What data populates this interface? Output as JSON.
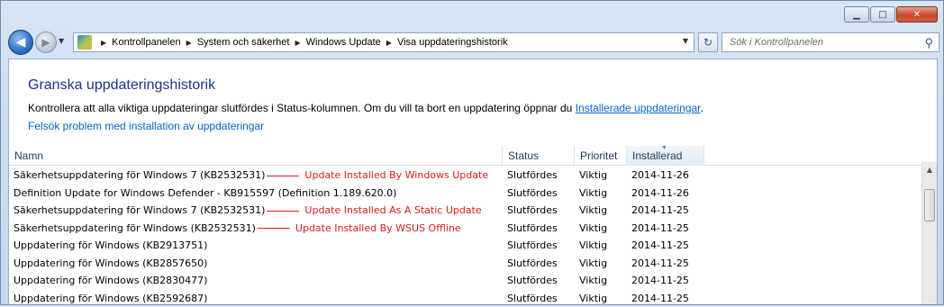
{
  "window": {
    "caption_buttons": {
      "minimize": "▁",
      "maximize": "□",
      "close": "✕"
    }
  },
  "nav": {
    "back_icon": "◀",
    "forward_icon": "▶",
    "breadcrumbs": [
      "Kontrollpanelen",
      "System och säkerhet",
      "Windows Update",
      "Visa uppdateringshistorik"
    ],
    "search_placeholder": "Sök i Kontrollpanelen"
  },
  "page": {
    "title": "Granska uppdateringshistorik",
    "description": "Kontrollera att alla viktiga uppdateringar slutfördes i Status-kolumnen. Om du vill ta bort en uppdatering öppnar du ",
    "description_link": "Installerade uppdateringar",
    "description_end": ".",
    "troubleshoot_link": "Felsök problem med installation av uppdateringar"
  },
  "table": {
    "columns": [
      "Namn",
      "Status",
      "Prioritet",
      "Installerad"
    ],
    "rows": [
      {
        "name": "Säkerhetsuppdatering för Windows 7 (KB2532531)",
        "annotation": "Update Installed By Windows Update",
        "status": "Slutfördes",
        "priority": "Viktig",
        "date": "2014-11-26"
      },
      {
        "name": "Definition Update for Windows Defender - KB915597 (Definition 1.189.620.0)",
        "annotation": "",
        "status": "Slutfördes",
        "priority": "Viktig",
        "date": "2014-11-26"
      },
      {
        "name": "Säkerhetsuppdatering för Windows 7 (KB2532531)",
        "annotation": "Update Installed As A Static Update",
        "status": "Slutfördes",
        "priority": "Viktig",
        "date": "2014-11-25"
      },
      {
        "name": "Säkerhetsuppdatering för Windows (KB2532531)",
        "annotation": "Update Installed By WSUS Offline",
        "status": "Slutfördes",
        "priority": "Viktig",
        "date": "2014-11-25"
      },
      {
        "name": "Uppdatering för Windows (KB2913751)",
        "annotation": "",
        "status": "Slutfördes",
        "priority": "Viktig",
        "date": "2014-11-25"
      },
      {
        "name": "Uppdatering för Windows (KB2857650)",
        "annotation": "",
        "status": "Slutfördes",
        "priority": "Viktig",
        "date": "2014-11-25"
      },
      {
        "name": "Uppdatering för Windows (KB2830477)",
        "annotation": "",
        "status": "Slutfördes",
        "priority": "Viktig",
        "date": "2014-11-25"
      },
      {
        "name": "Uppdatering för Windows (KB2592687)",
        "annotation": "",
        "status": "Slutfördes",
        "priority": "Viktig",
        "date": "2014-11-25"
      }
    ]
  },
  "colors": {
    "annotation": "#e01b1b",
    "title": "#1e3287",
    "link": "#0066cc"
  }
}
